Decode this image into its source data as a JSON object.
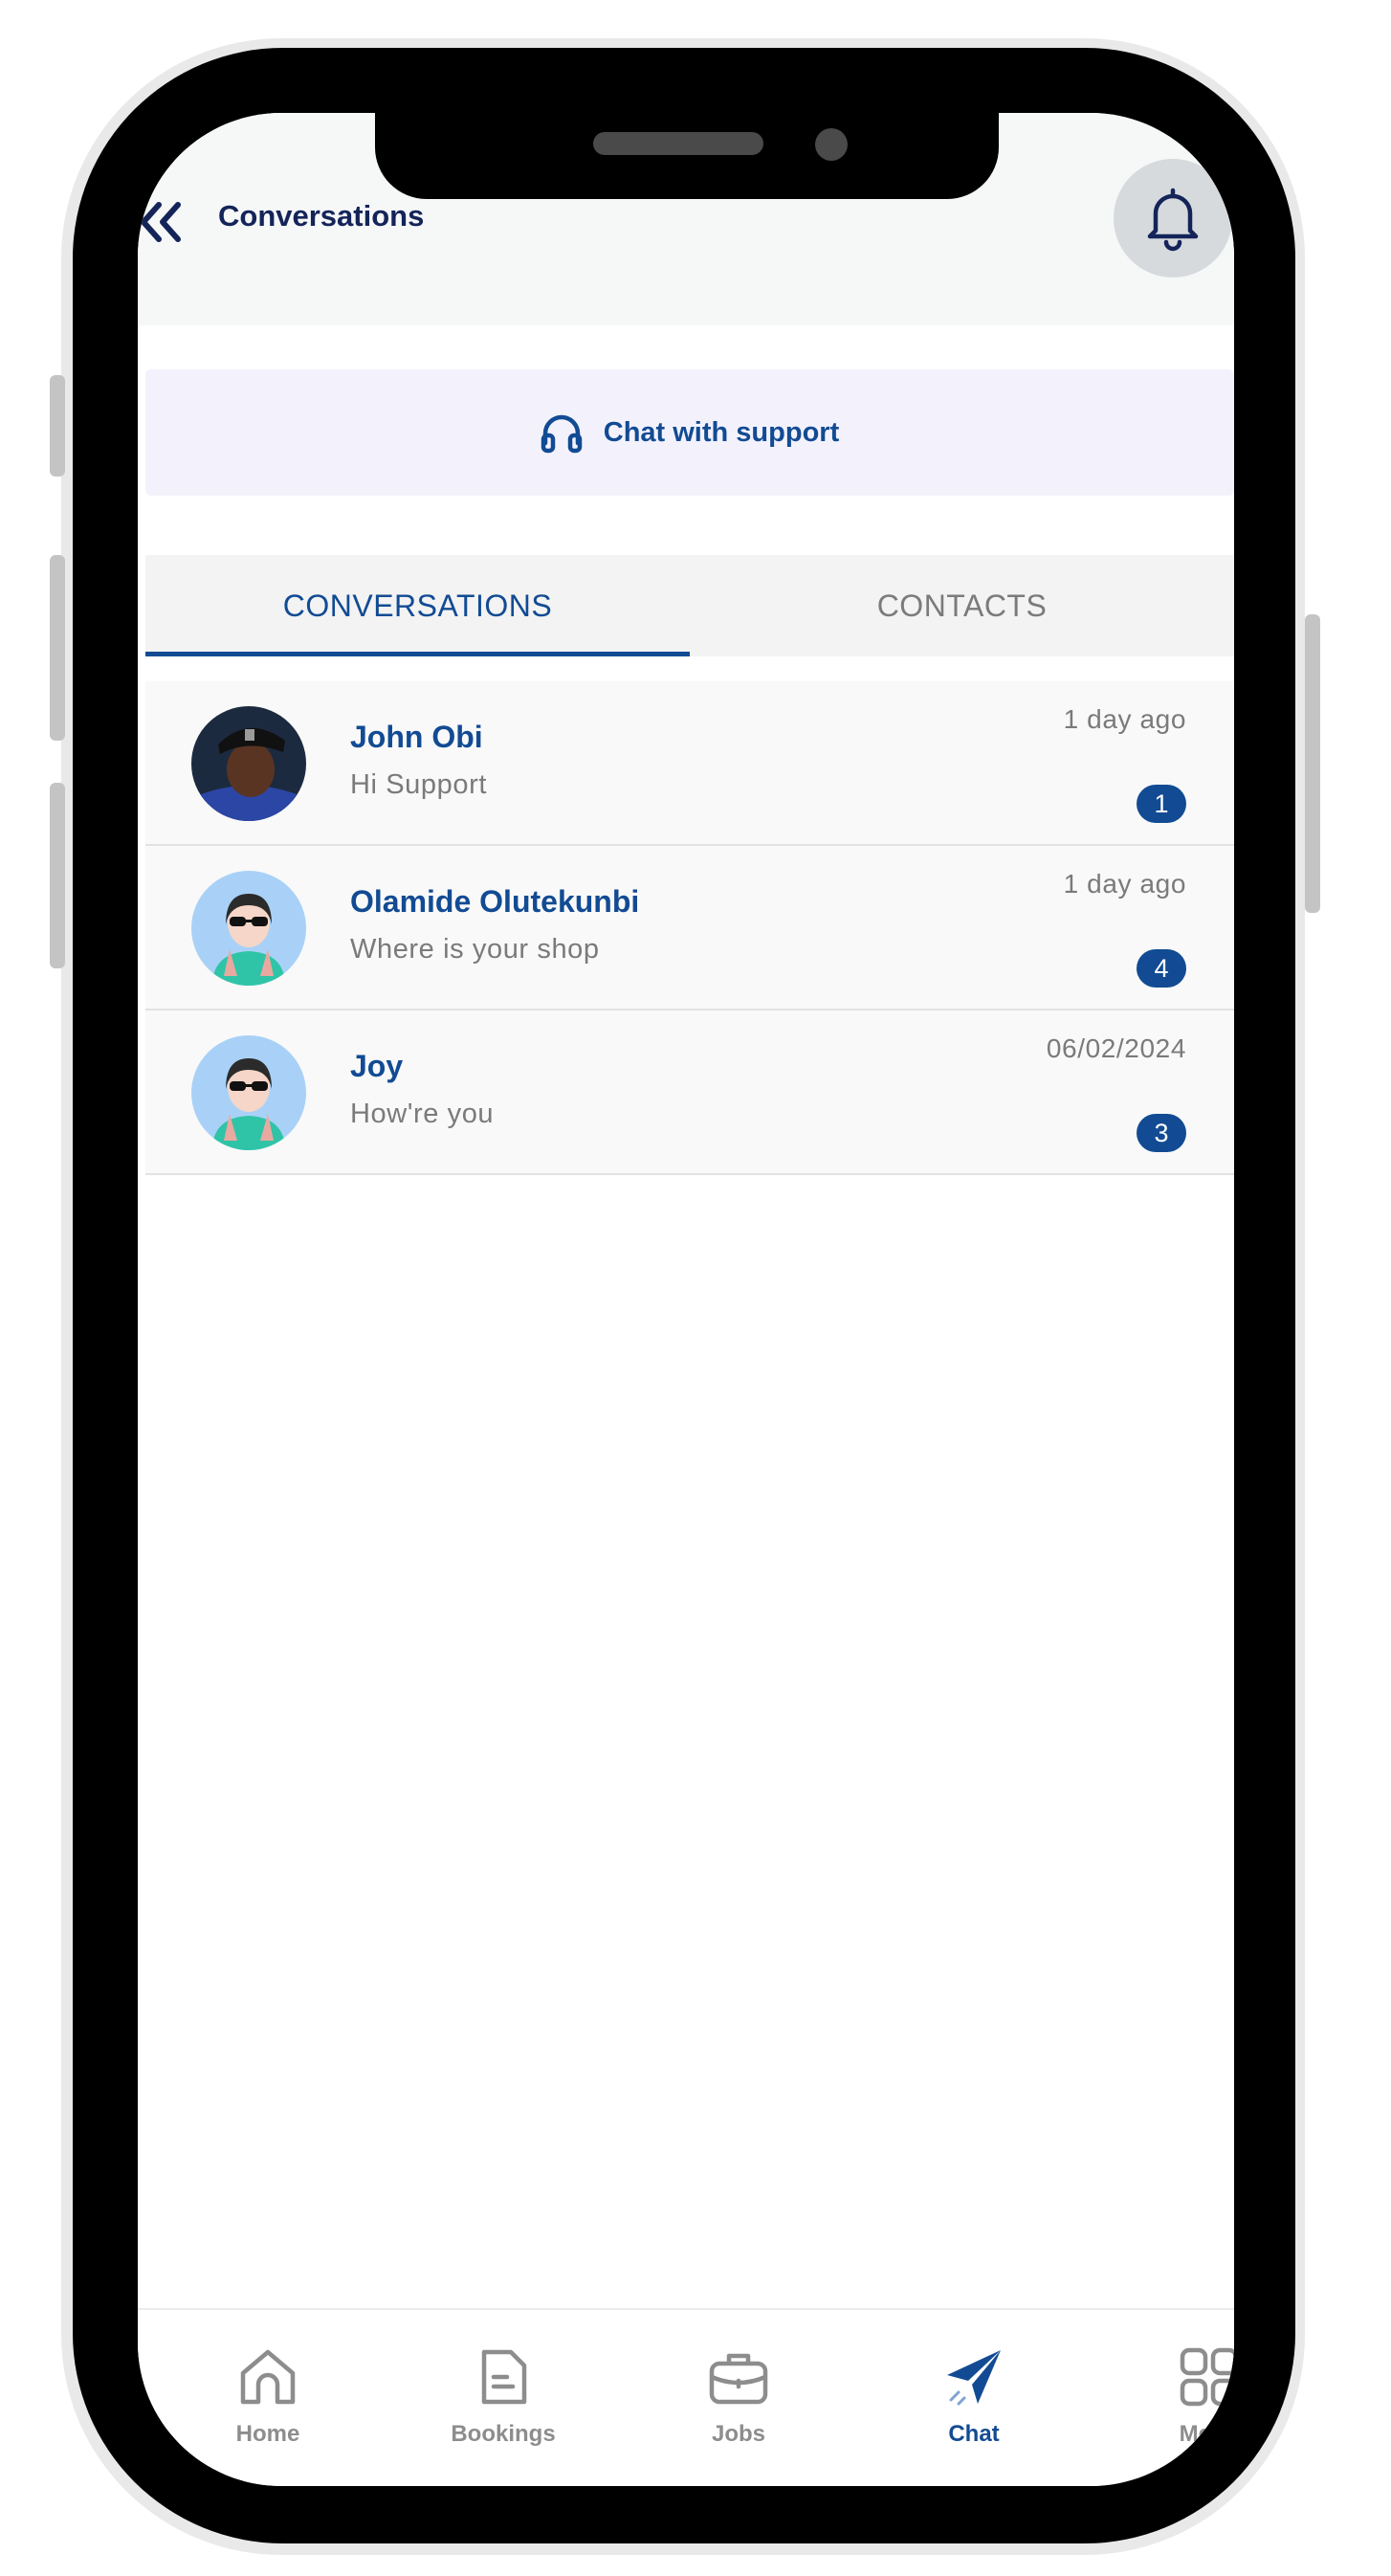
{
  "header": {
    "title": "Conversations",
    "back_icon": "double-chevron-left-icon",
    "bell_icon": "bell-icon"
  },
  "support": {
    "label": "Chat with support",
    "icon": "headphones-icon"
  },
  "tabs": [
    {
      "label": "CONVERSATIONS",
      "active": true
    },
    {
      "label": "CONTACTS",
      "active": false
    }
  ],
  "conversations": [
    {
      "name": "John Obi",
      "message": "Hi Support",
      "time": "1 day ago",
      "unread": "1",
      "avatar": "photo"
    },
    {
      "name": "Olamide Olutekunbi",
      "message": "Where is your shop",
      "time": "1 day ago",
      "unread": "4",
      "avatar": "illustrated-woman"
    },
    {
      "name": "Joy",
      "message": "How're you",
      "time": "06/02/2024",
      "unread": "3",
      "avatar": "illustrated-woman"
    }
  ],
  "nav": [
    {
      "label": "Home",
      "icon": "home-icon",
      "active": false
    },
    {
      "label": "Bookings",
      "icon": "document-icon",
      "active": false
    },
    {
      "label": "Jobs",
      "icon": "briefcase-icon",
      "active": false
    },
    {
      "label": "Chat",
      "icon": "send-icon",
      "active": true
    },
    {
      "label": "Menu",
      "icon": "grid-icon",
      "active": false
    }
  ],
  "colors": {
    "primary": "#124b93",
    "title": "#142459",
    "muted": "#7a7a7a",
    "support_bg": "#f3f2fc"
  }
}
